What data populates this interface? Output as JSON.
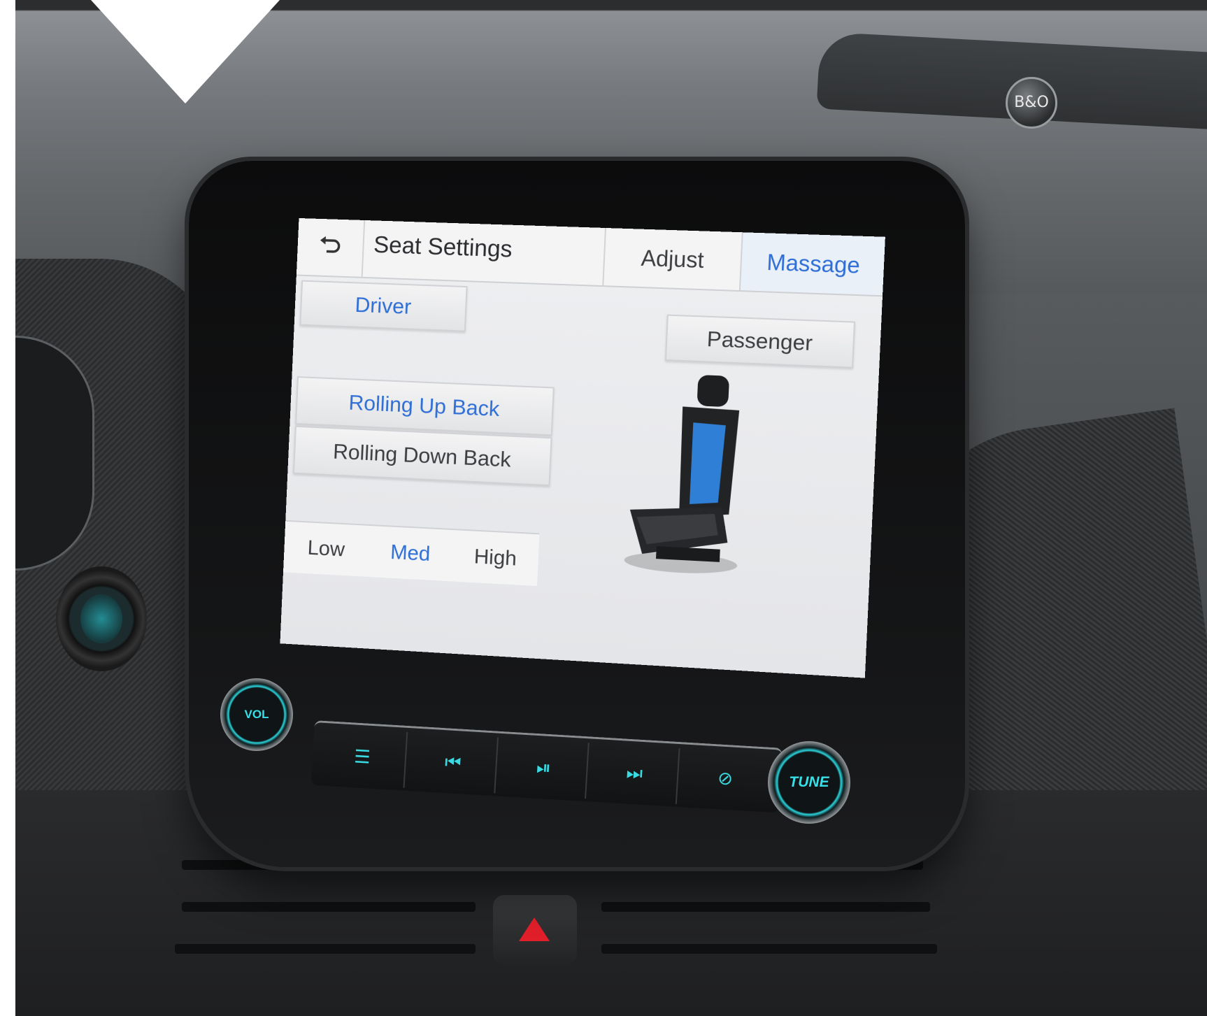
{
  "header": {
    "back_icon": "back-arrow-icon",
    "title": "Seat Settings",
    "tabs": [
      {
        "label": "Adjust",
        "selected": false
      },
      {
        "label": "Massage",
        "selected": true
      }
    ]
  },
  "seat_select": {
    "driver_label": "Driver",
    "passenger_label": "Passenger",
    "selected": "Driver"
  },
  "massage_modes": {
    "rolling_up_label": "Rolling Up Back",
    "rolling_down_label": "Rolling Down Back",
    "selected": "Rolling Up Back"
  },
  "intensity": {
    "levels": [
      "Low",
      "Med",
      "High"
    ],
    "selected": "Med"
  },
  "seat_graphic": {
    "icon": "seat-icon",
    "highlight_zone": "back",
    "highlight_color": "#2f7fd6"
  },
  "controls": {
    "vol_label": "VOL",
    "tune_label": "TUNE",
    "buttons": [
      {
        "icon": "equalizer-icon"
      },
      {
        "icon": "previous-track-icon"
      },
      {
        "icon": "play-pause-icon"
      },
      {
        "icon": "next-track-icon"
      },
      {
        "icon": "mute-icon"
      }
    ]
  },
  "brand_badge": "B&O",
  "colors": {
    "accent_blue": "#2f6fd6",
    "control_cyan": "#36e0e8",
    "hazard_red": "#e01f2a"
  }
}
